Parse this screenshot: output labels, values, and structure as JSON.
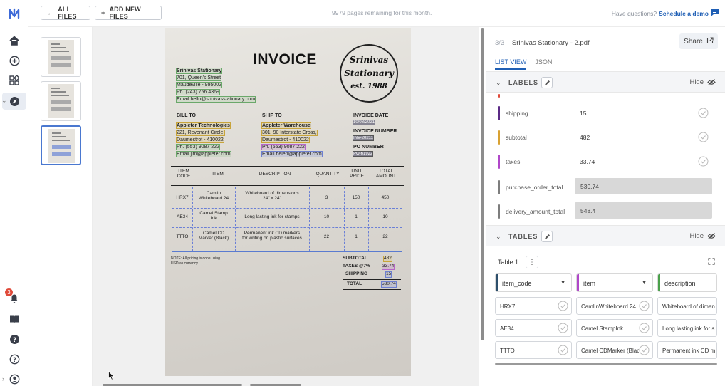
{
  "topbar": {
    "all_files": "ALL FILES",
    "add_new_files": "ADD NEW FILES",
    "pages_remaining": "9979 pages remaining for this month.",
    "questions": "Have questions?",
    "schedule_demo": "Schedule a demo"
  },
  "nav": {
    "notification_count": "3"
  },
  "panel": {
    "file_counter": "3/3",
    "file_name": "Srinivas Stationary - 2.pdf",
    "share_label": "Share",
    "tabs": [
      {
        "label": "LIST VIEW"
      },
      {
        "label": "JSON"
      }
    ],
    "labels_section": {
      "title": "LABELS",
      "hide": "Hide"
    },
    "fields": [
      {
        "name": "shipping",
        "value": "15",
        "color": "#5b2a86"
      },
      {
        "name": "subtotal",
        "value": "482",
        "color": "#d9a233"
      },
      {
        "name": "taxes",
        "value": "33.74",
        "color": "#b047c9"
      },
      {
        "name": "purchase_order_total",
        "value": "530.74",
        "color": "#7d7d7d"
      },
      {
        "name": "delivery_amount_total",
        "value": "548.4",
        "color": "#7d7d7d"
      }
    ],
    "tables_section": {
      "title": "TABLES",
      "hide": "Hide"
    },
    "table": {
      "title": "Table 1",
      "columns": [
        {
          "label": "item_code",
          "color": "#2d4f6b"
        },
        {
          "label": "item",
          "color": "#b047c9"
        },
        {
          "label": "description",
          "color": "#4aa04a"
        }
      ],
      "rows": [
        [
          "HRX7",
          "CamlinWhiteboard 24",
          "Whiteboard of dimen"
        ],
        [
          "AE34",
          "Camel StampInk",
          "Long lasting ink for s"
        ],
        [
          "TTTO",
          "Camel CDMarker (Blac",
          "Permanent ink CD m"
        ]
      ]
    }
  },
  "invoice": {
    "title": "INVOICE",
    "stamp": {
      "line1": "Srinivas",
      "line2": "Stationary",
      "line3": "est. 1988"
    },
    "seller": [
      "Srinivas Stationary",
      "701, Queen's Street",
      "Maudeville - 995002",
      "Ph. (243) 756 4369",
      "Email hello@srinivasstationary.com"
    ],
    "bill_to_label": "BILL TO",
    "bill_to": [
      "Appleter Technologies",
      "221, Revenant Circle,",
      "Daumestrot - 410022",
      "Ph. (553) 9087 222",
      "Email jim@appleter.com"
    ],
    "ship_to_label": "SHIP TO",
    "ship_to": [
      "Appleter Warehouse",
      "301, 90 Interstate Cross,",
      "Daumestrot - 410022",
      "Ph. (553) 9087 222",
      "Email helen@appleter.com"
    ],
    "invoice_date_label": "INVOICE DATE",
    "invoice_date": "10/08/2021",
    "invoice_number_label": "INVOICE NUMBER",
    "invoice_number": "INV-20211",
    "po_number_label": "PO NUMBER",
    "po_number": "PO-61922",
    "table_headers": [
      "ITEM\nCODE",
      "ITEM",
      "DESCRIPTION",
      "QUANTITY",
      "UNIT\nPRICE",
      "TOTAL\nAMOUNT"
    ],
    "items": [
      {
        "code": "HRX7",
        "item": "Camlin\nWhiteboard 24",
        "desc": "Whiteboard of dimensions\n24\" x 24\"",
        "qty": "3",
        "price": "150",
        "total": "450"
      },
      {
        "code": "AE34",
        "item": "Camel Stamp\nInk",
        "desc": "Long lasting ink for stamps",
        "qty": "10",
        "price": "1",
        "total": "10"
      },
      {
        "code": "TTTO",
        "item": "Camel CD\nMarker (Black)",
        "desc": "Permanent ink CD markers\nfor writing on plastic surfaces",
        "qty": "22",
        "price": "1",
        "total": "22"
      }
    ],
    "note": "NOTE: All pricing is done using\nUSD as currency",
    "subtotal_label": "SUBTOTAL",
    "subtotal": "482",
    "taxes_label": "TAXES @7%",
    "taxes": "33.74",
    "shipping_label": "SHIPPING",
    "shipping": "15",
    "total_label": "TOTAL",
    "total": "530.74"
  }
}
